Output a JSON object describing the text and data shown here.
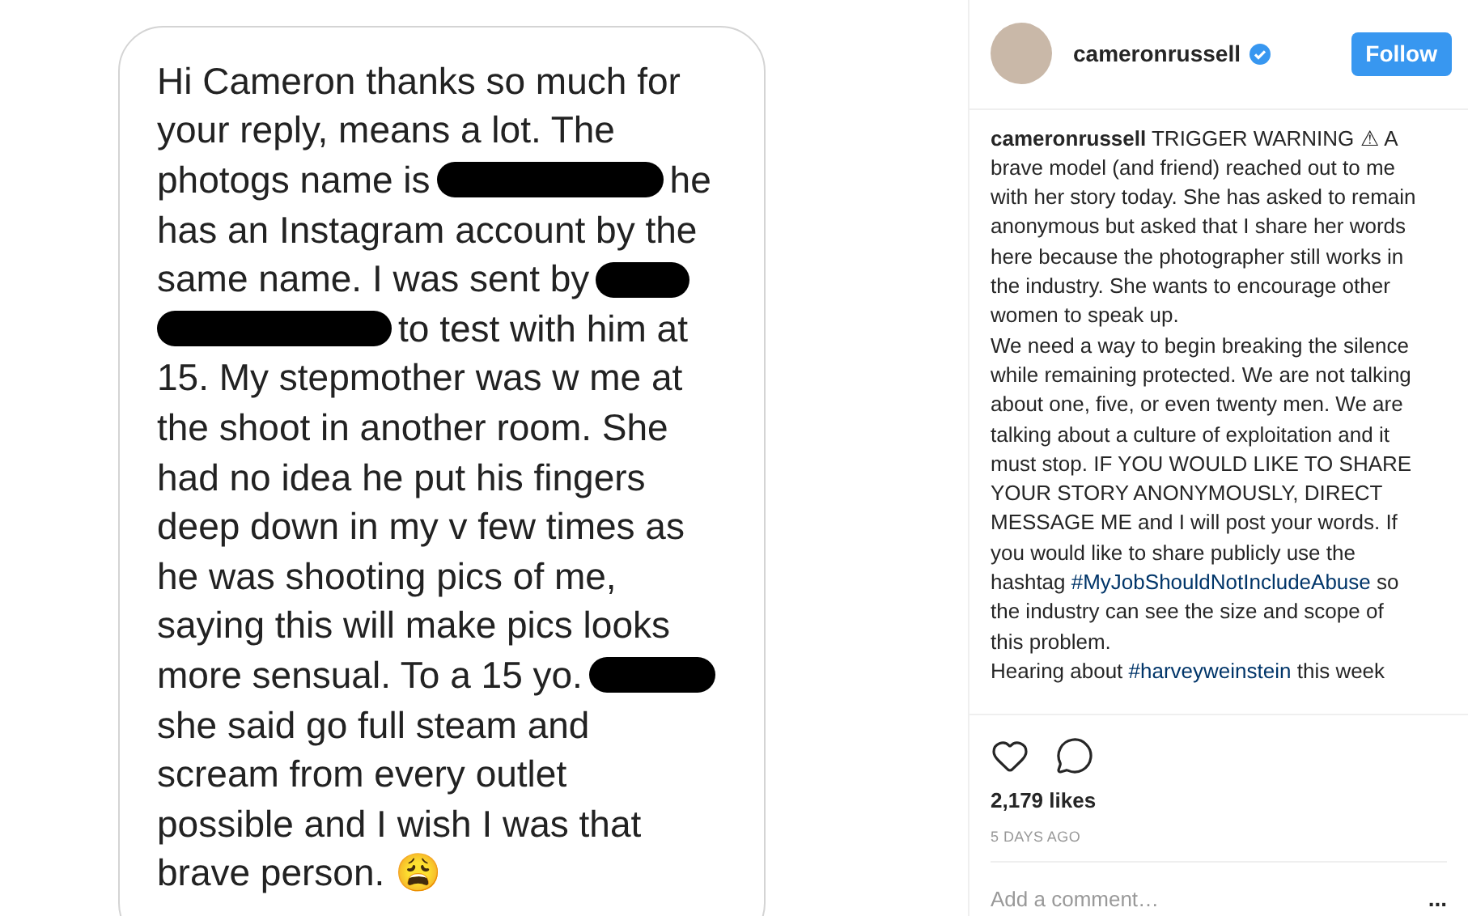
{
  "post_image": {
    "message_lines": [
      [
        {
          "kind": "text",
          "text": "Hi Cameron thanks so much for"
        }
      ],
      [
        {
          "kind": "text",
          "text": "your reply, means a lot. The"
        }
      ],
      [
        {
          "kind": "text",
          "text": "photogs name is"
        },
        {
          "kind": "redaction"
        },
        {
          "kind": "text",
          "text": "he"
        }
      ],
      [
        {
          "kind": "text",
          "text": "has an Instagram account by the"
        }
      ],
      [
        {
          "kind": "text",
          "text": "same name. I was sent by"
        },
        {
          "kind": "redaction"
        }
      ],
      [
        {
          "kind": "redaction"
        },
        {
          "kind": "text",
          "text": "to test with him at"
        }
      ],
      [
        {
          "kind": "text",
          "text": "15. My stepmother was w me at"
        }
      ],
      [
        {
          "kind": "text",
          "text": "the shoot in another room. She"
        }
      ],
      [
        {
          "kind": "text",
          "text": "had no idea he put his fingers"
        }
      ],
      [
        {
          "kind": "text",
          "text": "deep down in my v few times as"
        }
      ],
      [
        {
          "kind": "text",
          "text": "he was shooting pics of me,"
        }
      ],
      [
        {
          "kind": "text",
          "text": "saying this will make pics looks"
        }
      ],
      [
        {
          "kind": "text",
          "text": "more sensual. To a 15 yo."
        },
        {
          "kind": "redaction"
        }
      ],
      [
        {
          "kind": "text",
          "text": "she said go full steam and"
        }
      ],
      [
        {
          "kind": "text",
          "text": "scream from every outlet"
        }
      ],
      [
        {
          "kind": "text",
          "text": "possible and I wish I was that"
        }
      ],
      [
        {
          "kind": "text",
          "text": "brave person. 😩"
        }
      ]
    ]
  },
  "header": {
    "username": "cameronrussell",
    "verified": true,
    "follow_button": "Follow"
  },
  "caption": {
    "paragraphs": [
      [
        {
          "kind": "username",
          "text": "cameronrussell"
        },
        {
          "kind": "text",
          "text": " TRIGGER WARNING ⚠ A brave model (and friend) reached out to me with her story today. She has asked to remain anonymous but asked that I share her words here because the photographer still works in the industry. She wants to encourage other women to speak up."
        }
      ],
      [
        {
          "kind": "text",
          "text": "We need a way to begin breaking the silence while remaining protected. We are not talking about one, five, or even twenty men. We are talking about a culture of exploitation and it must stop. IF YOU WOULD LIKE TO SHARE YOUR STORY ANONYMOUSLY, DIRECT MESSAGE ME and I will post your words. If you would like to share publicly use the hashtag "
        },
        {
          "kind": "hashtag",
          "text": "#MyJobShouldNotIncludeAbuse"
        },
        {
          "kind": "text",
          "text": " so the industry can see the size and scope of this problem."
        }
      ],
      [
        {
          "kind": "text",
          "text": "Hearing about "
        },
        {
          "kind": "hashtag",
          "text": "#harveyweinstein"
        },
        {
          "kind": "text",
          "text": " this week"
        }
      ]
    ]
  },
  "likes": "2,179 likes",
  "timestamp": "5 DAYS AGO",
  "comment": {
    "placeholder": "Add a comment…",
    "more": "..."
  }
}
